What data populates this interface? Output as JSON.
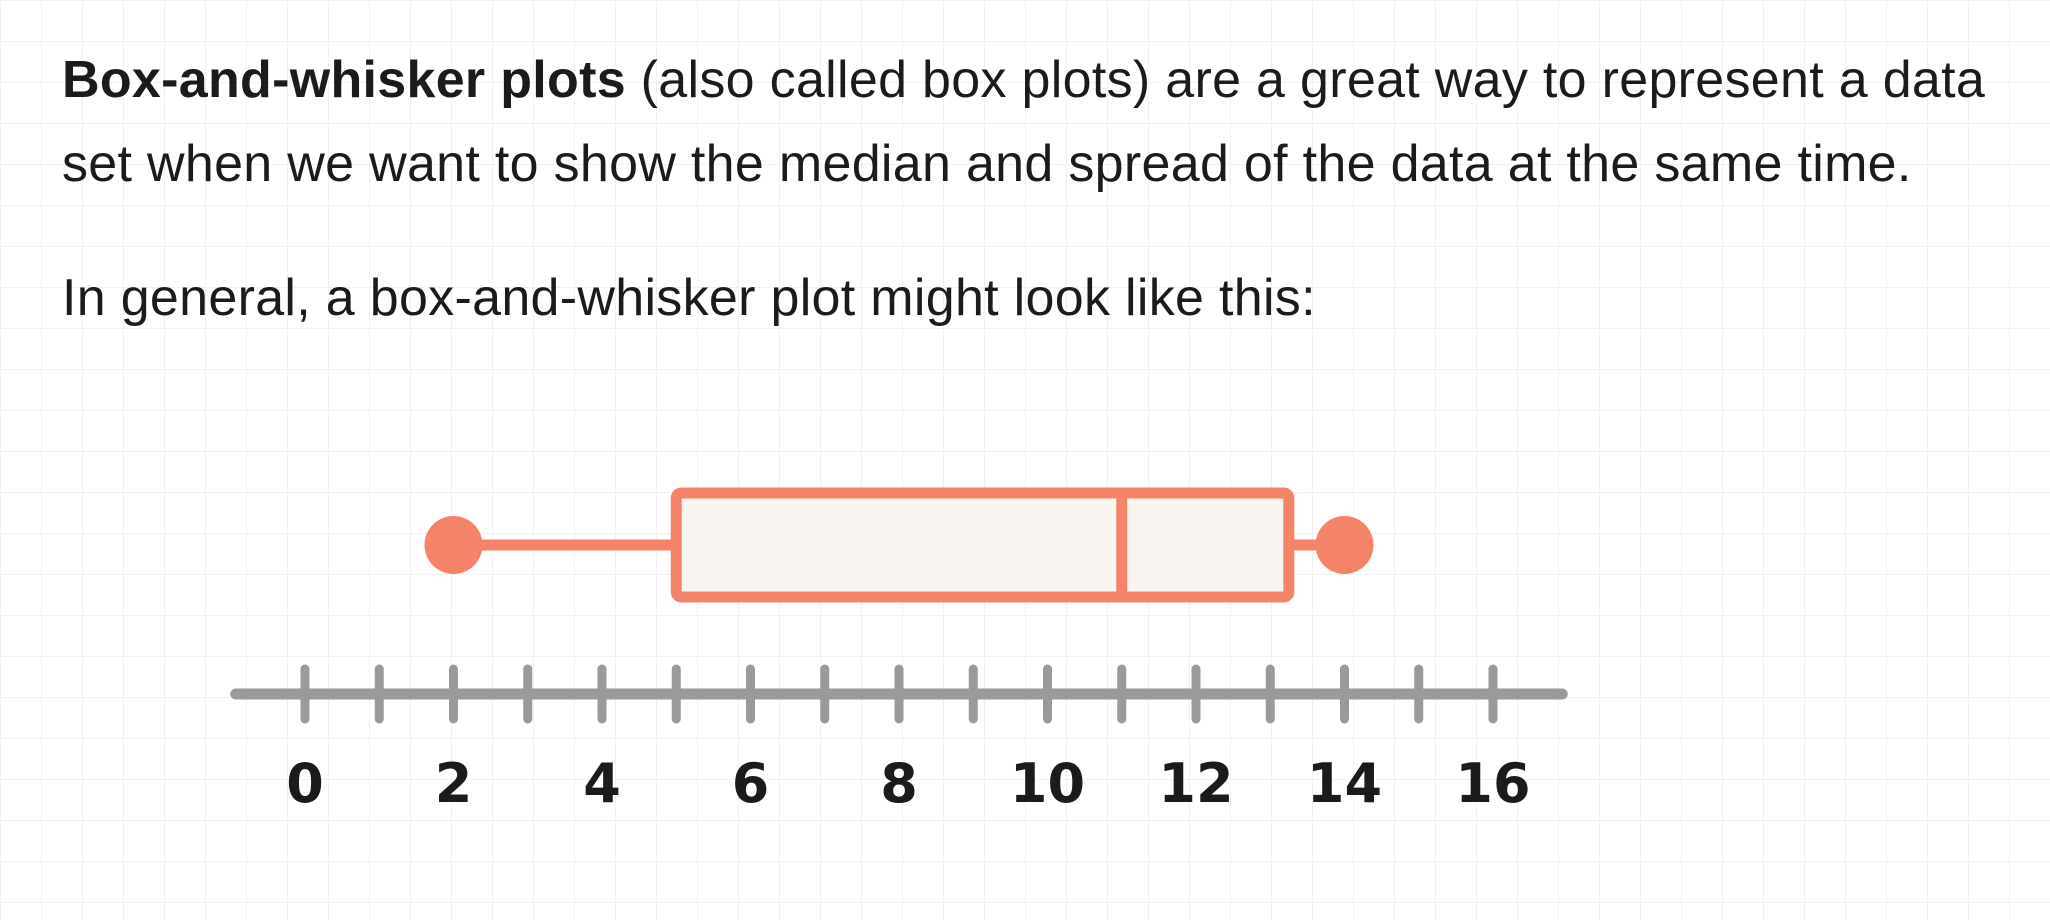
{
  "intro": {
    "bold_term": "Box-and-whisker plots",
    "rest": " (also called box plots) are a great way to represent a data set when we want to show the median and spread of the data at the same time."
  },
  "lead_in": "In general, a box-and-whisker plot might look like this:",
  "colors": {
    "box_stroke": "#f4836a",
    "box_fill": "#f8f5f0",
    "axis": "#9a9a9a",
    "label": "#1b1b1b"
  },
  "chart_data": {
    "type": "box",
    "min": 2,
    "q1": 5,
    "median": 11,
    "q3": 13.25,
    "max": 14,
    "axis": {
      "range": [
        -1,
        17
      ],
      "major_ticks": [
        0,
        1,
        2,
        3,
        4,
        5,
        6,
        7,
        8,
        9,
        10,
        11,
        12,
        13,
        14,
        15,
        16
      ],
      "tick_labels": [
        "0",
        "2",
        "4",
        "6",
        "8",
        "10",
        "12",
        "14",
        "16"
      ]
    }
  }
}
